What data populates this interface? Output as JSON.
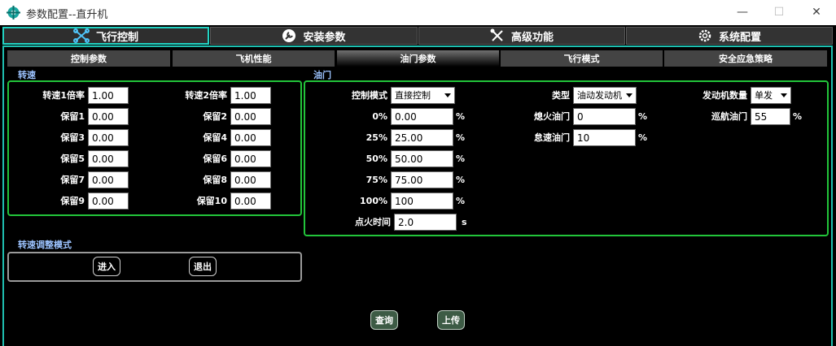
{
  "window": {
    "title": "参数配置--直升机",
    "minimize": "—",
    "maximize": "☐",
    "close": "✕"
  },
  "main_tabs": [
    {
      "label": "飞行控制",
      "icon": "drone-icon"
    },
    {
      "label": "安装参数",
      "icon": "wrench-icon"
    },
    {
      "label": "高级功能",
      "icon": "tools-icon"
    },
    {
      "label": "系统配置",
      "icon": "gear-icon"
    }
  ],
  "sub_tabs": [
    "控制参数",
    "飞机性能",
    "油门参数",
    "飞行模式",
    "安全应急策略"
  ],
  "active_sub_tab": "油门参数",
  "rpm": {
    "title": "转速",
    "fields": [
      {
        "label": "转速1倍率",
        "value": "1.00"
      },
      {
        "label": "转速2倍率",
        "value": "1.00"
      },
      {
        "label": "保留1",
        "value": "0.00"
      },
      {
        "label": "保留2",
        "value": "0.00"
      },
      {
        "label": "保留3",
        "value": "0.00"
      },
      {
        "label": "保留4",
        "value": "0.00"
      },
      {
        "label": "保留5",
        "value": "0.00"
      },
      {
        "label": "保留6",
        "value": "0.00"
      },
      {
        "label": "保留7",
        "value": "0.00"
      },
      {
        "label": "保留8",
        "value": "0.00"
      },
      {
        "label": "保留9",
        "value": "0.00"
      },
      {
        "label": "保留10",
        "value": "0.00"
      }
    ]
  },
  "rpm_adjust": {
    "title": "转速调整模式",
    "enter": "进入",
    "exit": "退出"
  },
  "throttle": {
    "title": "油门",
    "control_mode_label": "控制模式",
    "control_mode_value": "直接控制",
    "curve": [
      {
        "label": "0%",
        "value": "0.00",
        "unit": "%"
      },
      {
        "label": "25%",
        "value": "25.00",
        "unit": "%"
      },
      {
        "label": "50%",
        "value": "50.00",
        "unit": "%"
      },
      {
        "label": "75%",
        "value": "75.00",
        "unit": "%"
      },
      {
        "label": "100%",
        "value": "100",
        "unit": "%"
      }
    ],
    "ignition_label": "点火时间",
    "ignition_value": "2.0",
    "ignition_unit": "s",
    "type_label": "类型",
    "type_value": "油动发动机",
    "kill_label": "熄火油门",
    "kill_value": "0",
    "kill_unit": "%",
    "idle_label": "怠速油门",
    "idle_value": "10",
    "idle_unit": "%",
    "engine_count_label": "发动机数量",
    "engine_count_value": "单发",
    "cruise_label": "巡航油门",
    "cruise_value": "55",
    "cruise_unit": "%"
  },
  "actions": {
    "query": "查询",
    "upload": "上传"
  },
  "colors": {
    "accent": "#22d3c3",
    "group_border": "#22c43a",
    "section_label": "#9cc3ff",
    "action_button": "#3d5b45"
  }
}
